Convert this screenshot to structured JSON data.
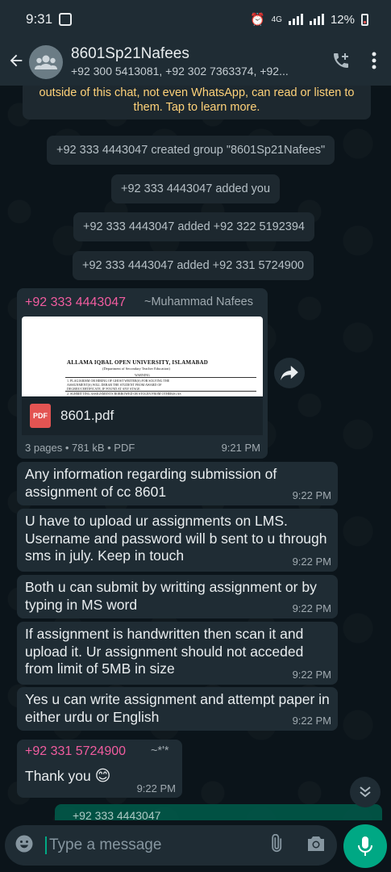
{
  "status_bar": {
    "time": "9:31",
    "network": "4G",
    "battery": "12%"
  },
  "header": {
    "back_icon": "arrow-left-icon",
    "avatar_icon": "group-avatar-icon",
    "title": "8601Sp21Nafees",
    "subtitle": "+92 300 5413081, +92 302 7363374, +92..."
  },
  "chat": {
    "encryption_notice": "outside of this chat, not even WhatsApp, can read or listen to them. Tap to learn more.",
    "system_messages": [
      "+92 333 4443047 created group \"8601Sp21Nafees\"",
      "+92 333 4443047 added you",
      "+92 333 4443047 added +92 322 5192394",
      "+92 333 4443047 added +92 331 5724900"
    ],
    "document_message": {
      "sender_phone": "+92 333 4443047",
      "sender_name": "~Muhammad Nafees",
      "preview_title": "ALLAMA IQBAL OPEN UNIVERSITY, ISLAMABAD",
      "preview_subtitle": "(Department of Secondary Teacher Education)",
      "preview_lines": [
        "WARNING",
        "1. PLAGIARISM OR HIRING OF GHOST WRITER(S) FOR SOLVING THE",
        "ASSIGNMENT(S) WILL DEBAR THE STUDENT FROM AWARD OF",
        "DEGREE/CERTIFICATE, IF FOUND AT ANY STAGE.",
        "2. SUBMITTING ASSIGNMENTS BORROWED OR STOLEN FROM OTHER(S) AS"
      ],
      "file_name": "8601.pdf",
      "file_type_badge": "PDF",
      "meta": "3 pages • 781 kB • PDF",
      "time": "9:21 PM"
    },
    "messages": [
      {
        "text": "Any information regarding submission of assignment of cc 8601",
        "time": "9:22 PM"
      },
      {
        "text": "U have to upload ur assignments on LMS. Username and password will b sent to u through sms in july. Keep in touch",
        "time": "9:22 PM"
      },
      {
        "text": "Both u can submit by writting assignment or by typing in MS word",
        "time": "9:22 PM"
      },
      {
        "text": "If assignment is handwritten then scan it and upload it. Ur assignment should not acceded from limit of 5MB in size",
        "time": "9:22 PM"
      },
      {
        "text": "Yes u can write assignment and attempt paper in either urdu or English",
        "time": "9:22 PM"
      }
    ],
    "reply_message": {
      "sender_phone": "+92 331 5724900",
      "sender_name": "~*'*",
      "text": "Thank you",
      "emoji": "😊",
      "time": "9:22 PM"
    },
    "partial_outgoing": "+92 333 4443047"
  },
  "composer": {
    "placeholder": "Type a message",
    "emoji_icon": "emoji-icon",
    "attach_icon": "paperclip-icon",
    "camera_icon": "camera-icon",
    "mic_icon": "mic-icon"
  },
  "colors": {
    "background": "#0b141a",
    "bar": "#1f2c34",
    "bubble_in": "#1f2c34",
    "bubble_out": "#005c4b",
    "accent": "#00a884",
    "sender": "#f15c9f",
    "notice": "#ffd279"
  }
}
